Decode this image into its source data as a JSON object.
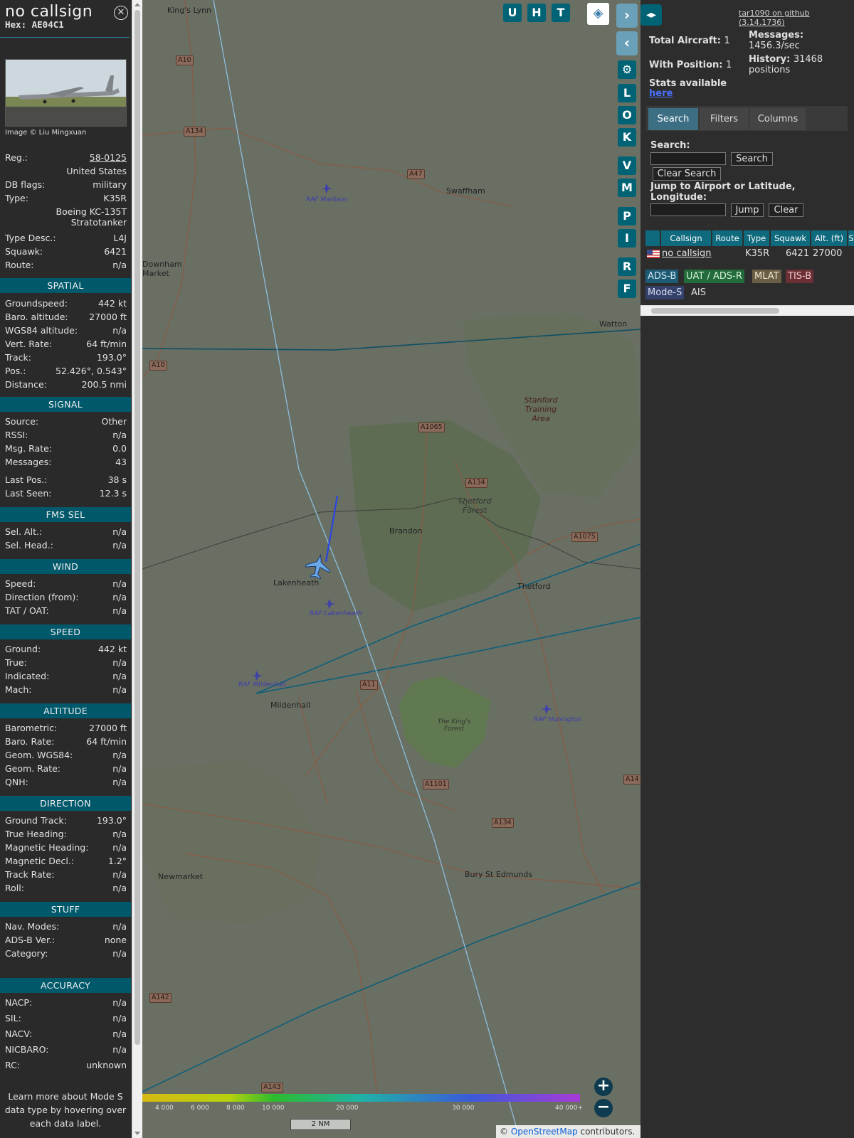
{
  "info": {
    "callsign": "no callsign",
    "hex": "Hex: AE04C1",
    "photo_credit": "Image © Liu Mingxuan",
    "reg_label": "Reg.:",
    "reg_value": "58-0125",
    "country": "United States",
    "dbflags_label": "DB flags:",
    "dbflags_value": "military",
    "type_label": "Type:",
    "type_value": "K35R",
    "type_full_1": "Boeing KC-135T",
    "type_full_2": "Stratotanker",
    "typedesc_label": "Type Desc.:",
    "typedesc_value": "L4J",
    "squawk_label": "Squawk:",
    "squawk_value": "6421",
    "route_label": "Route:",
    "route_value": "n/a",
    "sections": {
      "spatial": "SPATIAL",
      "signal": "SIGNAL",
      "fms": "FMS SEL",
      "wind": "WIND",
      "speed": "SPEED",
      "altitude": "ALTITUDE",
      "direction": "DIRECTION",
      "stuff": "STUFF",
      "accuracy": "ACCURACY"
    },
    "spatial": [
      [
        "Groundspeed:",
        "442 kt"
      ],
      [
        "Baro. altitude:",
        "27000 ft"
      ],
      [
        "WGS84 altitude:",
        "n/a"
      ],
      [
        "Vert. Rate:",
        "64 ft/min"
      ],
      [
        "Track:",
        "193.0°"
      ],
      [
        "Pos.:",
        "52.426°, 0.543°"
      ],
      [
        "Distance:",
        "200.5 nmi"
      ]
    ],
    "signal": [
      [
        "Source:",
        "Other"
      ],
      [
        "RSSI:",
        "n/a"
      ],
      [
        "Msg. Rate:",
        "0.0"
      ],
      [
        "Messages:",
        "43"
      ],
      [
        "Last Pos.:",
        "38 s"
      ],
      [
        "Last Seen:",
        "12.3 s"
      ]
    ],
    "fms": [
      [
        "Sel. Alt.:",
        "n/a"
      ],
      [
        "Sel. Head.:",
        "n/a"
      ]
    ],
    "wind": [
      [
        "Speed:",
        "n/a"
      ],
      [
        "Direction (from):",
        "n/a"
      ],
      [
        "TAT / OAT:",
        "n/a"
      ]
    ],
    "speed": [
      [
        "Ground:",
        "442 kt"
      ],
      [
        "True:",
        "n/a"
      ],
      [
        "Indicated:",
        "n/a"
      ],
      [
        "Mach:",
        "n/a"
      ]
    ],
    "altitude": [
      [
        "Barometric:",
        "27000 ft"
      ],
      [
        "Baro. Rate:",
        "64 ft/min"
      ],
      [
        "Geom. WGS84:",
        "n/a"
      ],
      [
        "Geom. Rate:",
        "n/a"
      ],
      [
        "QNH:",
        "n/a"
      ]
    ],
    "direction": [
      [
        "Ground Track:",
        "193.0°"
      ],
      [
        "True Heading:",
        "n/a"
      ],
      [
        "Magnetic Heading:",
        "n/a"
      ],
      [
        "Magnetic Decl.:",
        "1.2°"
      ],
      [
        "Track Rate:",
        "n/a"
      ],
      [
        "Roll:",
        "n/a"
      ]
    ],
    "stuff": [
      [
        "Nav. Modes:",
        "n/a"
      ],
      [
        "ADS-B Ver.:",
        "none"
      ],
      [
        "Category:",
        "n/a"
      ]
    ],
    "accuracy": [
      [
        "NACP:",
        "n/a"
      ],
      [
        "SIL:",
        "n/a"
      ],
      [
        "NACV:",
        "n/a"
      ],
      [
        "NICBARO:",
        "n/a"
      ],
      [
        "RC:",
        "unknown"
      ]
    ],
    "footer_1": "Learn more about Mode S",
    "footer_2": "data type by hovering over",
    "footer_3": "each data label."
  },
  "map": {
    "buttons": [
      "U",
      "H",
      "T"
    ],
    "side_buttons": [
      "L",
      "O",
      "K",
      "V",
      "M",
      "P",
      "I",
      "R",
      "F"
    ],
    "places": [
      {
        "name": "King's Lynn"
      },
      {
        "name": "Swaffham"
      },
      {
        "name": "RAF Marham"
      },
      {
        "name": "Watton"
      },
      {
        "name": "Stanford Training Area"
      },
      {
        "name": "Thetford Forest"
      },
      {
        "name": "Brandon"
      },
      {
        "name": "Lakenheath"
      },
      {
        "name": "RAF Lakenheath"
      },
      {
        "name": "Thetford"
      },
      {
        "name": "RAF Mildenhall"
      },
      {
        "name": "Mildenhall"
      },
      {
        "name": "The King's Forest"
      },
      {
        "name": "RAF Honington"
      },
      {
        "name": "Newmarket"
      },
      {
        "name": "Bury St Edmunds"
      },
      {
        "name": "Downham Market"
      }
    ],
    "roads": [
      "A10",
      "A134",
      "A47",
      "A10",
      "A1065",
      "A134",
      "A1075",
      "A11",
      "A1101",
      "A134",
      "A142",
      "A143",
      "A14"
    ],
    "altitude_scale": [
      "4 000",
      "6 000",
      "8 000",
      "10 000",
      "20 000",
      "30 000",
      "40 000+"
    ],
    "scale_label": "2 NM",
    "attribution_prefix": "© ",
    "attribution_link": "OpenStreetMap",
    "attribution_suffix": " contributors."
  },
  "sidebar": {
    "github_link": "tar1090 on github (3.14.1736)",
    "total_aircraft_label": "Total Aircraft:",
    "total_aircraft_value": "1",
    "with_position_label": "With Position:",
    "with_position_value": "1",
    "messages_label": "Messages:",
    "messages_value": "1456.3/sec",
    "history_label": "History:",
    "history_value": "31468",
    "history_unit": "positions",
    "stats_label": "Stats available",
    "stats_link": "here",
    "tabs": [
      "Search",
      "Filters",
      "Columns"
    ],
    "search_label": "Search:",
    "search_button": "Search",
    "clear_search_button": "Clear Search",
    "jump_label_1": "Jump to Airport or Latitude,",
    "jump_label_2": "Longitude:",
    "jump_button": "Jump",
    "clear_button": "Clear",
    "table_headers": [
      "Callsign",
      "Route",
      "Type",
      "Squawk",
      "Alt. (ft)",
      "S"
    ],
    "table_row": {
      "callsign": "no callsign",
      "route": "",
      "type": "K35R",
      "squawk": "6421",
      "alt": "27000"
    },
    "sources": [
      "ADS-B",
      "UAT / ADS-R",
      "MLAT",
      "TIS-B",
      "Mode-S",
      "AIS"
    ]
  },
  "colors": {
    "section_bg": "#00596b",
    "accent": "#006375",
    "adsb": "#1d5b75",
    "uat": "#226b3a",
    "mlat": "#6b5e47",
    "tisb": "#6b2f35",
    "modes": "#34416b"
  }
}
